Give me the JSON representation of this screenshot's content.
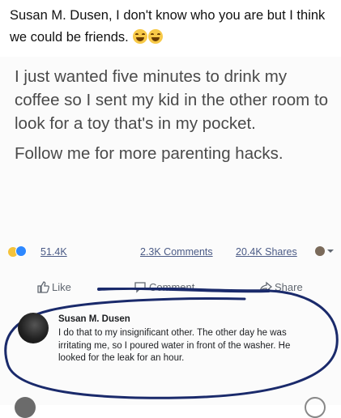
{
  "caption": {
    "text": "Susan M. Dusen, I don't know who you are but I think we could be friends.",
    "emojis": [
      "face-with-tears-of-joy-icon",
      "rolling-on-floor-laughing-icon"
    ]
  },
  "post": {
    "paragraph1": "I just wanted five minutes to drink my coffee so I sent my kid in the other room to look for a toy that's in my pocket.",
    "paragraph2": "Follow me for more parenting hacks."
  },
  "stats": {
    "reactions_count": "51.4K",
    "comments": "2.3K Comments",
    "shares": "20.4K Shares"
  },
  "actions": {
    "like": "Like",
    "comment": "Comment",
    "share": "Share"
  },
  "comment": {
    "author": "Susan M. Dusen",
    "text": "I do that to my insignificant other.  The other day he was irritating me, so I poured water in front of the washer.  He looked for the leak for an hour."
  },
  "colors": {
    "link": "#4b5b86",
    "ink_circle": "#1a2a6b"
  }
}
